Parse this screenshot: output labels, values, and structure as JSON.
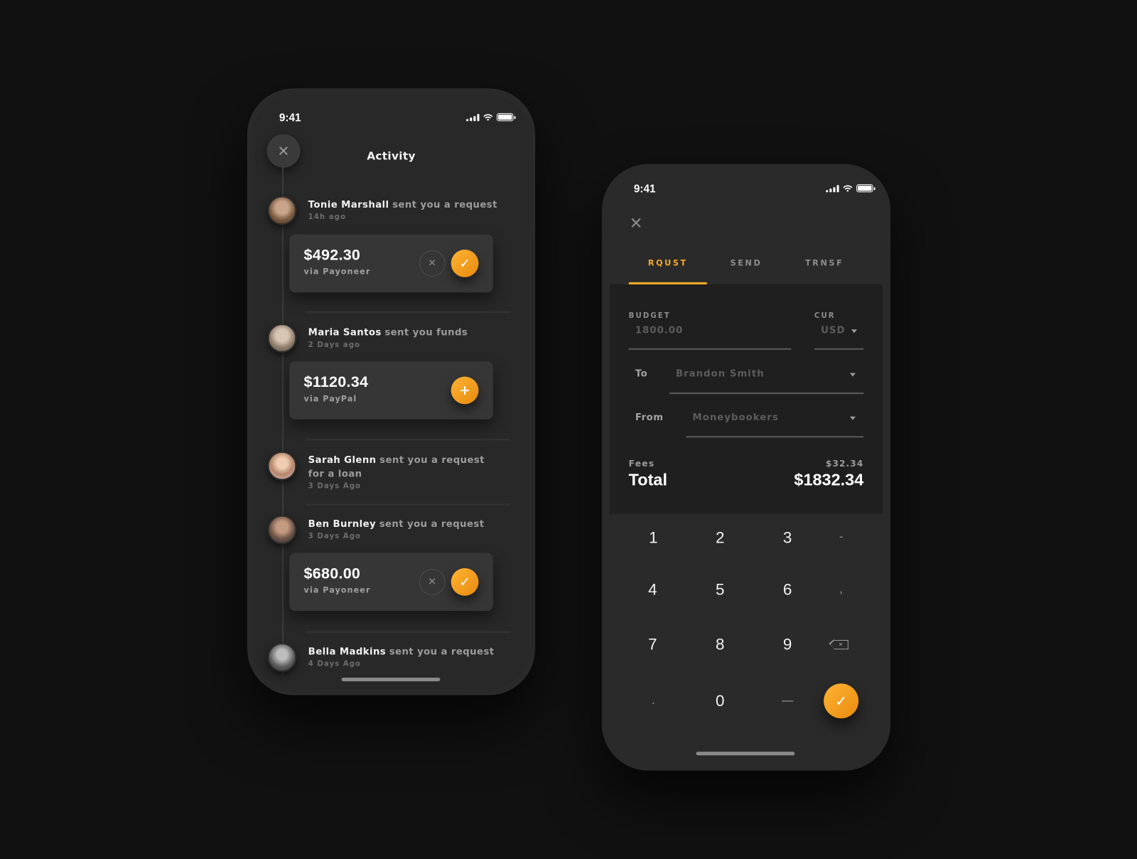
{
  "activity_screen": {
    "status_time": "9:41",
    "title": "Activity",
    "close_icon": "close-icon",
    "feed": [
      {
        "name": "Tonie Marshall",
        "action": "sent you a request",
        "time": "14h ago",
        "avatar_color": "#7a5a40",
        "card": {
          "amount": "$492.30",
          "via": "via Payoneer",
          "actions": [
            "decline",
            "accept"
          ]
        }
      },
      {
        "name": "Maria Santos",
        "action": "sent you funds",
        "time": "2 Days ago",
        "avatar_color": "#8f7c6c",
        "card": {
          "amount": "$1120.34",
          "via": "via PayPal",
          "actions": [
            "add"
          ]
        }
      },
      {
        "name": "Sarah Glenn",
        "action": "sent you a request for a loan",
        "time": "3 Days Ago",
        "avatar_color": "#b5866a"
      },
      {
        "name": "Ben Burnley",
        "action": "sent you a request",
        "time": "3 Days Ago",
        "avatar_color": "#6d5446",
        "card": {
          "amount": "$680.00",
          "via": "via Payoneer",
          "actions": [
            "decline",
            "accept"
          ]
        }
      },
      {
        "name": "Bella Madkins",
        "action": "sent you a request",
        "time": "4 Days Ago",
        "avatar_color": "#5a5a5a"
      }
    ],
    "icons": {
      "decline": "✕",
      "accept": "✓",
      "add": "+"
    }
  },
  "transfer_screen": {
    "status_time": "9:41",
    "close_icon": "✕",
    "tabs": [
      {
        "label": "RQUST",
        "active": true
      },
      {
        "label": "SEND",
        "active": false
      },
      {
        "label": "TRNSF",
        "active": false
      }
    ],
    "budget": {
      "label": "BUDGET",
      "value": "1800.00"
    },
    "currency": {
      "label": "CUR",
      "value": "USD"
    },
    "to": {
      "label": "To",
      "value": "Brandon Smith"
    },
    "from": {
      "label": "From",
      "value": "Moneybookers"
    },
    "fees": {
      "label": "Fees",
      "value": "$32.34"
    },
    "total": {
      "label": "Total",
      "value": "$1832.34"
    },
    "keypad": {
      "rows": [
        [
          "1",
          "2",
          "3",
          "-"
        ],
        [
          "4",
          "5",
          "6",
          ","
        ],
        [
          "7",
          "8",
          "9",
          "⌫"
        ],
        [
          ".",
          "0",
          "—",
          "✓"
        ]
      ]
    },
    "accent_color": "#f2a828"
  },
  "colors": {
    "background": "#111111",
    "phone_body": "#2a2a2a",
    "card": "#363636",
    "accent": "#f2a828"
  }
}
